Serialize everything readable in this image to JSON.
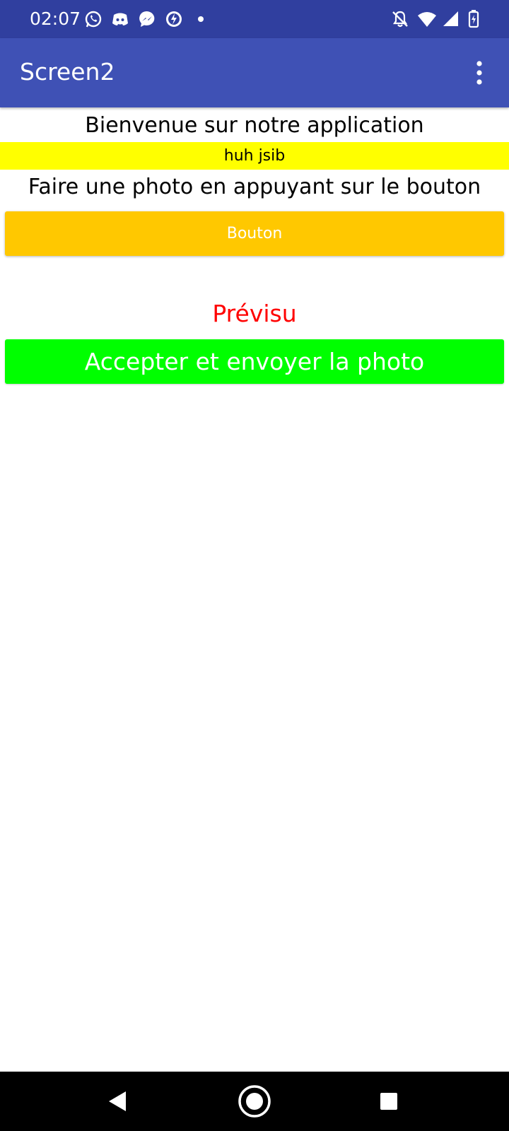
{
  "status_bar": {
    "time": "02:07",
    "left_icons": [
      "whatsapp-icon",
      "discord-icon",
      "messenger-icon",
      "power-icon",
      "dot-icon"
    ],
    "right_icons": [
      "notifications-off-icon",
      "wifi-icon",
      "signal-icon",
      "battery-charging-icon"
    ]
  },
  "app_bar": {
    "title": "Screen2",
    "menu_icon": "more-vert-icon"
  },
  "content": {
    "welcome_text": "Bienvenue sur notre application",
    "yellow_label": "huh jsib",
    "instruction_text": "Faire une photo en appuyant sur le bouton",
    "photo_button_label": "Bouton",
    "preview_label": "Prévisu",
    "accept_button_label": "Accepter et envoyer la photo"
  },
  "nav_bar": {
    "buttons": [
      "back-icon",
      "home-icon",
      "recents-icon"
    ]
  },
  "colors": {
    "status_bar": "#303f9f",
    "app_bar": "#3f51b5",
    "yellow_label": "#ffff00",
    "photo_button": "#ffc800",
    "preview_text": "#ff0000",
    "accept_button": "#00ff00"
  }
}
